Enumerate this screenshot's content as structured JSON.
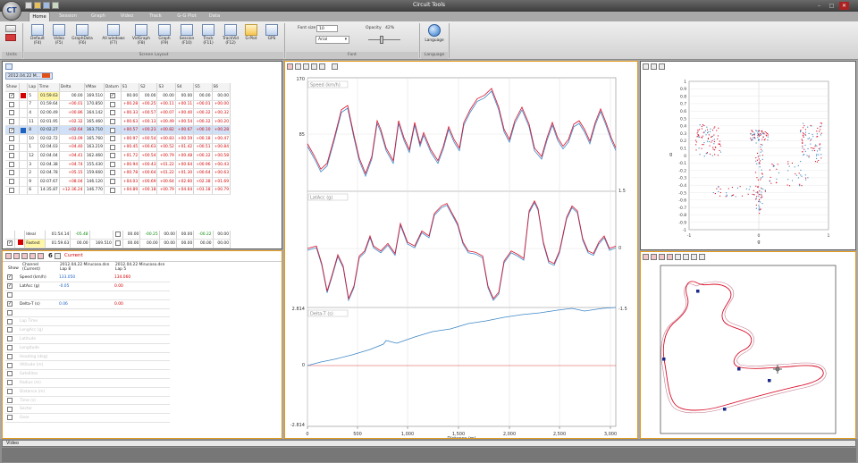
{
  "app": {
    "title": "Circuit Tools"
  },
  "tabs": [
    "Home",
    "Session",
    "Graph",
    "Video",
    "Track",
    "G-G Plot",
    "Data"
  ],
  "ribbon": {
    "units_group": "Units",
    "screen_layout_group": "Screen Layout",
    "font_group": "Font",
    "language_group": "Language",
    "buttons": [
      {
        "label": "Default",
        "key": "(F4)"
      },
      {
        "label": "Video",
        "key": "(F5)"
      },
      {
        "label": "GraphData",
        "key": "(F6)"
      },
      {
        "label": "All windows",
        "key": "(F7)"
      },
      {
        "label": "VidGraph",
        "key": "(F8)"
      },
      {
        "label": "Graph",
        "key": "(F9)"
      },
      {
        "label": "Session",
        "key": "(F10)"
      },
      {
        "label": "Track",
        "key": "(F11)"
      },
      {
        "label": "TrackVid",
        "key": "(F12)"
      },
      {
        "label": "G-Plot",
        "key": ""
      },
      {
        "label": "GPS",
        "key": ""
      }
    ],
    "font_size_label": "Font size",
    "font_size_value": "10",
    "font_name": "Arial",
    "opacity_label": "Opacity",
    "opacity_value": "42%",
    "language_label": "Language"
  },
  "laps": {
    "session_label": "2012.04.22 M...",
    "headers": [
      "Show",
      "",
      "Lap",
      "Time",
      "Delta",
      "VMax",
      "Datum",
      "S1",
      "S2",
      "S3",
      "S4",
      "S5",
      "S6"
    ],
    "rows": [
      {
        "show": true,
        "color": "#d40000",
        "lap": "5",
        "time": "01:59.63",
        "delta": "00.00",
        "vmax": "169.510",
        "datum": true,
        "s": [
          "00.00",
          "00.00",
          "00.00",
          "00.00",
          "00.00",
          "00.00"
        ],
        "hl": "datum"
      },
      {
        "show": false,
        "color": "",
        "lap": "7",
        "time": "01:59.64",
        "delta": "+00.01",
        "vmax": "170.850",
        "datum": false,
        "s": [
          "+00.28",
          "+00.25",
          "+00.11",
          "+00.11",
          "+00.01",
          "+00.00"
        ]
      },
      {
        "show": false,
        "color": "",
        "lap": "4",
        "time": "02:00.49",
        "delta": "+00.86",
        "vmax": "164.142",
        "datum": false,
        "s": [
          "+00.33",
          "+00.57",
          "+00.07",
          "+00.40",
          "+00.32",
          "+00.32"
        ]
      },
      {
        "show": false,
        "color": "",
        "lap": "11",
        "time": "02:01.95",
        "delta": "+02.32",
        "vmax": "165.460",
        "datum": false,
        "s": [
          "+00.63",
          "+00.13",
          "+00.49",
          "+00.54",
          "+00.32",
          "+00.20"
        ]
      },
      {
        "show": true,
        "color": "#1f63c2",
        "lap": "8",
        "time": "02:02.27",
        "delta": "+02.64",
        "vmax": "163.710",
        "datum": false,
        "s": [
          "+00.57",
          "+00.23",
          "+00.82",
          "+00.67",
          "+00.10",
          "+00.28"
        ],
        "hl": "sel"
      },
      {
        "show": false,
        "color": "",
        "lap": "10",
        "time": "02:02.72",
        "delta": "+03.09",
        "vmax": "165.760",
        "datum": false,
        "s": [
          "+00.97",
          "+00.54",
          "+00.83",
          "+00.59",
          "+00.18",
          "+00.47"
        ]
      },
      {
        "show": false,
        "color": "",
        "lap": "1",
        "time": "02:04.03",
        "delta": "+04.40",
        "vmax": "163.219",
        "datum": false,
        "s": [
          "+00.45",
          "+00.63",
          "+00.52",
          "+01.42",
          "+00.51",
          "+00.84"
        ]
      },
      {
        "show": false,
        "color": "",
        "lap": "12",
        "time": "02:04.04",
        "delta": "+04.41",
        "vmax": "162.460",
        "datum": false,
        "s": [
          "+01.72",
          "+00.54",
          "+00.79",
          "+00.48",
          "+00.32",
          "+00.58"
        ]
      },
      {
        "show": false,
        "color": "",
        "lap": "3",
        "time": "02:04.38",
        "delta": "+04.74",
        "vmax": "155.430",
        "datum": false,
        "s": [
          "+00.94",
          "+00.43",
          "+01.22",
          "+00.64",
          "+00.96",
          "+00.43"
        ]
      },
      {
        "show": false,
        "color": "",
        "lap": "2",
        "time": "02:04.78",
        "delta": "+05.15",
        "vmax": "159.660",
        "datum": false,
        "s": [
          "+00.78",
          "+00.64",
          "+01.22",
          "+01.30",
          "+00.64",
          "+00.63"
        ]
      },
      {
        "show": false,
        "color": "",
        "lap": "9",
        "time": "02:07.67",
        "delta": "+08.04",
        "vmax": "146.120",
        "datum": false,
        "s": [
          "+04.03",
          "+00.69",
          "+00.64",
          "+02.60",
          "+02.38",
          "+01.69"
        ]
      },
      {
        "show": false,
        "color": "",
        "lap": "6",
        "time": "14:35.87",
        "delta": "+12:36.24",
        "vmax": "146.770",
        "datum": false,
        "s": [
          "+04.89",
          "+00.18",
          "+00.79",
          "+04.64",
          "+03.18",
          "+00.79"
        ]
      }
    ],
    "ideal": {
      "label": "Ideal",
      "time": "01:54.14",
      "delta": "-05.48",
      "s": [
        "00.00",
        "-00.25",
        "00.00",
        "00.00",
        "-00.22",
        "00.00"
      ]
    },
    "fastest": {
      "label": "Fastest",
      "time": "01:59.63",
      "delta": "00.00",
      "vmax": "169.510",
      "s": [
        "00.00",
        "00.00",
        "00.00",
        "00.00",
        "00.00",
        "00.00"
      ]
    }
  },
  "channels": {
    "current_label": "Current",
    "col_show": "Show",
    "col_channel": "Channel",
    "col_channel_sub": "(Current)",
    "lap_a": "2012.04.22 Mirucoso.dsn",
    "lap_a_sub": "Lap 8",
    "lap_b": "2012.04.22 Mirucoso.dsn",
    "lap_b_sub": "Lap 5",
    "rows": [
      {
        "show": true,
        "name": "Speed (km/h)",
        "a": "133.050",
        "b": "134.060",
        "dim": false
      },
      {
        "show": true,
        "name": "LatAcc (g)",
        "a": "-0.05",
        "b": "0.00",
        "dim": false
      },
      {
        "show": false,
        "name": "",
        "a": "",
        "b": "",
        "dim": false
      },
      {
        "show": true,
        "name": "Delta-T (s)",
        "a": "0.06",
        "b": "0.00",
        "dim": false
      },
      {
        "show": false,
        "name": "",
        "a": "",
        "b": "",
        "dim": false
      },
      {
        "show": false,
        "name": "Lap Time",
        "a": "",
        "b": "",
        "dim": true
      },
      {
        "show": false,
        "name": "LongAcc (g)",
        "a": "",
        "b": "",
        "dim": true
      },
      {
        "show": false,
        "name": "Latitude",
        "a": "",
        "b": "",
        "dim": true
      },
      {
        "show": false,
        "name": "Longitude",
        "a": "",
        "b": "",
        "dim": true
      },
      {
        "show": false,
        "name": "Heading (deg)",
        "a": "",
        "b": "",
        "dim": true
      },
      {
        "show": false,
        "name": "Altitude (m)",
        "a": "",
        "b": "",
        "dim": true
      },
      {
        "show": false,
        "name": "Satellites",
        "a": "",
        "b": "",
        "dim": true
      },
      {
        "show": false,
        "name": "Radius (m)",
        "a": "",
        "b": "",
        "dim": true
      },
      {
        "show": false,
        "name": "Distance (m)",
        "a": "",
        "b": "",
        "dim": true
      },
      {
        "show": false,
        "name": "Time (s)",
        "a": "",
        "b": "",
        "dim": true
      },
      {
        "show": false,
        "name": "Sector",
        "a": "",
        "b": "",
        "dim": true
      },
      {
        "show": false,
        "name": "Gear",
        "a": "",
        "b": "",
        "dim": true
      }
    ]
  },
  "graph": {
    "speed_label": "Speed (km/h)",
    "latacc_label": "LatAcc (g)",
    "deltat_label": "Delta-T (s)",
    "xlabel": "Distance (m)",
    "xticks": [
      "0",
      "500",
      "1,000",
      "1,500",
      "2,000",
      "2,500",
      "3,000"
    ],
    "speed_ticks": [
      "170",
      "85"
    ],
    "latacc_ticks": [
      "1.5",
      "0"
    ],
    "deltat_ticks_left": [
      "2.814",
      "0",
      "-2.814"
    ],
    "deltat_tick_right": "-1.5"
  },
  "ggplot": {
    "ylabel": "g",
    "xlabel": "g",
    "yticks": [
      "1",
      "0.9",
      "0.8",
      "0.7",
      "0.6",
      "0.5",
      "0.4",
      "0.3",
      "0.2",
      "0.1",
      "0",
      "-0.1",
      "-0.2",
      "-0.3",
      "-0.4",
      "-0.5",
      "-0.6",
      "-0.7",
      "-0.8",
      "-0.9",
      "-1"
    ],
    "xticks": [
      "-1",
      "0",
      "1"
    ]
  },
  "video": {
    "label": "Video"
  },
  "colors": {
    "lap_a": "#3d86c6",
    "lap_b": "#d8102a",
    "accent": "#e39a1c"
  }
}
